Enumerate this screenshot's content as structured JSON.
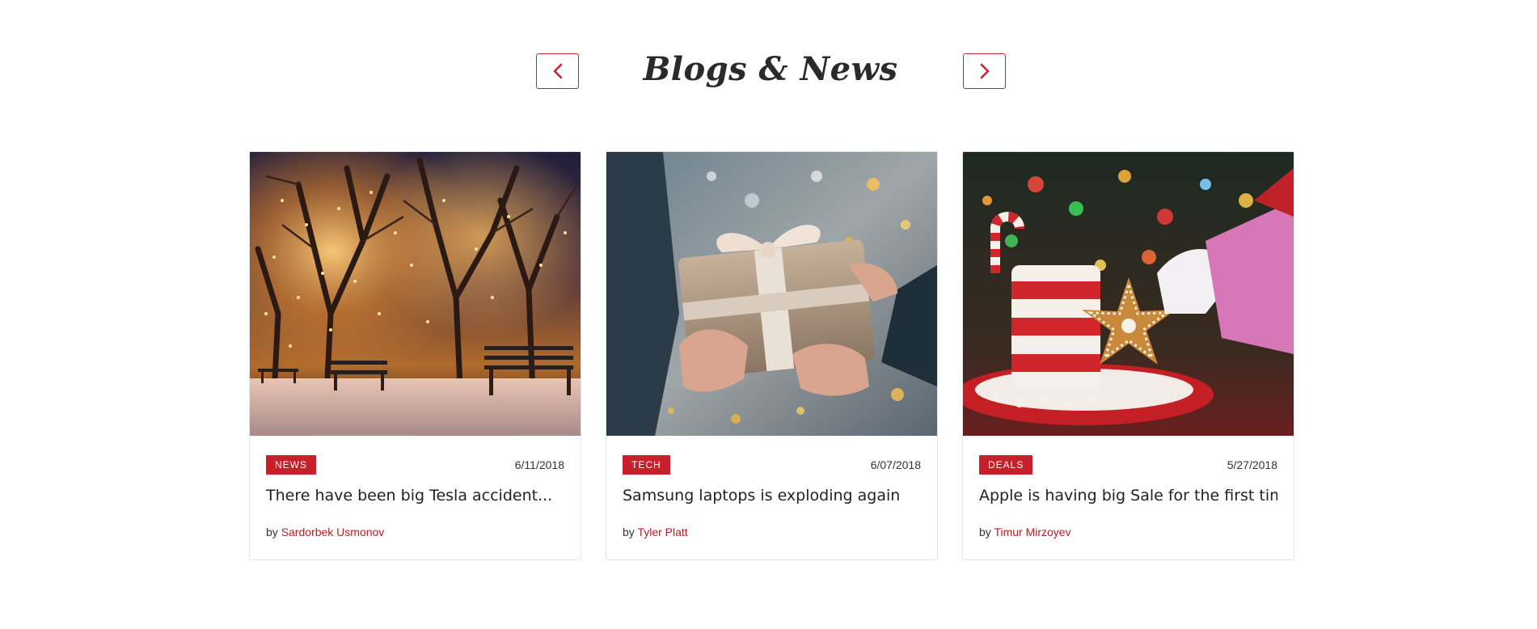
{
  "section": {
    "title": "Blogs & News",
    "prev_icon": "chevron-left-icon",
    "next_icon": "chevron-right-icon"
  },
  "colors": {
    "accent": "#c8202b",
    "border": "#e4e4e4",
    "text": "#222222"
  },
  "posts": [
    {
      "image": "snowy-park-lights-photo",
      "category": "NEWS",
      "date": "6/11/2018",
      "title": "There have been big Tesla accident...",
      "by_label": "by",
      "author": "Sardorbek Usmonov"
    },
    {
      "image": "gift-box-hands-photo",
      "category": "TECH",
      "date": "6/07/2018",
      "title": "Samsung laptops is exploding again",
      "by_label": "by",
      "author": "Tyler Platt"
    },
    {
      "image": "santa-cookie-mug-photo",
      "category": "DEALS",
      "date": "5/27/2018",
      "title": "Apple is having big Sale for the first time",
      "by_label": "by",
      "author": "Timur Mirzoyev"
    }
  ]
}
